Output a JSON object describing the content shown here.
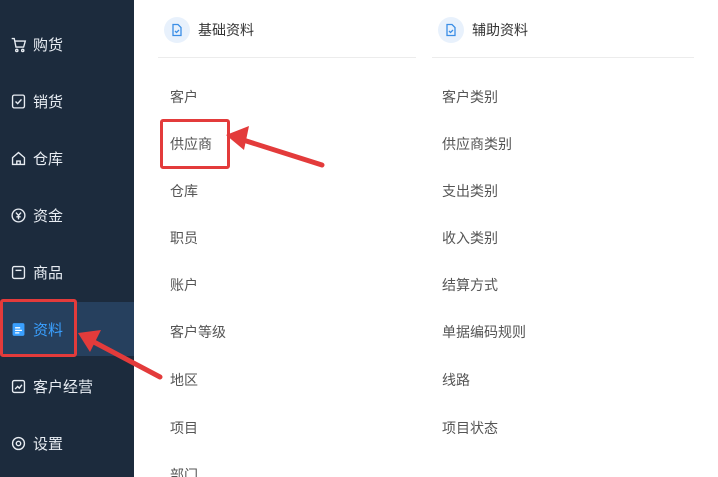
{
  "sidebar": {
    "items": [
      {
        "label": "购货",
        "icon": "cart-icon"
      },
      {
        "label": "销货",
        "icon": "sales-icon"
      },
      {
        "label": "仓库",
        "icon": "house-icon"
      },
      {
        "label": "资金",
        "icon": "money-icon"
      },
      {
        "label": "商品",
        "icon": "product-icon"
      },
      {
        "label": "资料",
        "icon": "document-icon",
        "active": true
      },
      {
        "label": "客户经营",
        "icon": "chart-icon"
      },
      {
        "label": "设置",
        "icon": "gear-icon"
      }
    ]
  },
  "main": {
    "basic": {
      "title": "基础资料",
      "items": [
        "客户",
        "供应商",
        "仓库",
        "职员",
        "账户",
        "客户等级",
        "地区",
        "项目",
        "部门"
      ]
    },
    "aux": {
      "title": "辅助资料",
      "items": [
        "客户类别",
        "供应商类别",
        "支出类别",
        "收入类别",
        "结算方式",
        "单据编码规则",
        "线路",
        "项目状态"
      ]
    }
  },
  "colors": {
    "sidebar_bg": "#1c2b3d",
    "active_bg": "#26405e",
    "accent": "#3aa0ff",
    "highlight": "#e33b3b"
  }
}
